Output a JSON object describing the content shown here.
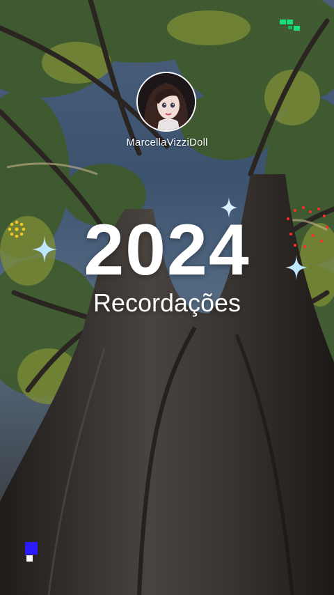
{
  "profile": {
    "username": "MarcellaVizziDoll",
    "avatar_icon": "doll-avatar"
  },
  "story": {
    "year": "2024",
    "title": "Recordações"
  },
  "colors": {
    "accent_green": "#19e07a",
    "accent_blue": "#2a1cff",
    "accent_red": "#ff2a2a",
    "accent_yellow": "#f3c623",
    "sparkle": "#bfe6ff"
  },
  "decorations": [
    "green-pixels-icon",
    "yellow-circle-dots-icon",
    "sparkle-icon",
    "red-dots-icon",
    "blue-square-icon"
  ]
}
